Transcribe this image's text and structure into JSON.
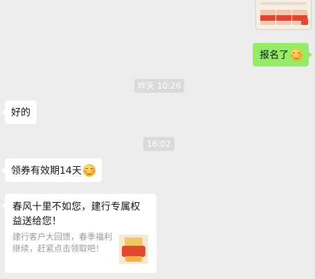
{
  "messages": {
    "sent_signup": "报名了",
    "time1": "昨天 10:26",
    "reply_ok": "好的",
    "time2": "16:02",
    "coupon_notice": "领券有效期14天",
    "card": {
      "title": "春风十里不如您，建行专属权益送给您！",
      "desc": "建行客户大回馈，春季福利继续，赶紧点击领取吧！"
    }
  },
  "icons": {
    "emoji": "smile-emoji-icon"
  },
  "colors": {
    "sent_bubble": "#95ec69",
    "chat_bg": "#ededed",
    "received_bubble": "#ffffff",
    "stamp_bg": "#dadada"
  }
}
